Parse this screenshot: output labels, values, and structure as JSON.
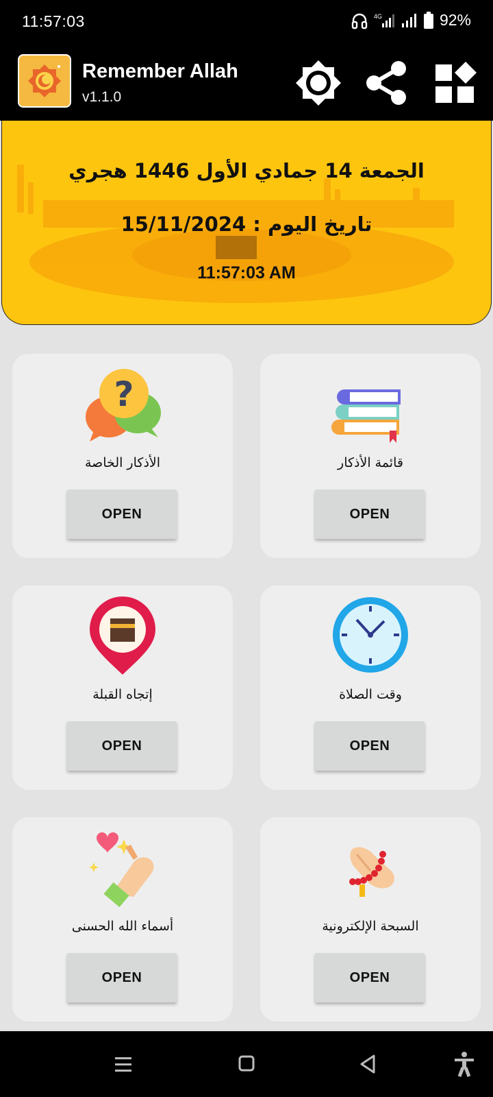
{
  "status_bar": {
    "time": "11:57:03",
    "network": "4G",
    "battery": "92%"
  },
  "app_bar": {
    "title": "Remember Allah",
    "version": "v1.1.0",
    "icons": [
      "brightness-icon",
      "share-icon",
      "apps-icon"
    ]
  },
  "banner": {
    "hijri_date": "الجمعة 14 جمادي الأول 1446 هجري",
    "gregorian_date": "تاريخ اليوم : 15/11/2024",
    "clock": "11:57:03 AM"
  },
  "cards": [
    {
      "label": "الأذكار الخاصة",
      "button": "OPEN",
      "icon": "question-chat-icon"
    },
    {
      "label": "قائمة الأذكار",
      "button": "OPEN",
      "icon": "books-icon"
    },
    {
      "label": "إتجاه القبلة",
      "button": "OPEN",
      "icon": "qibla-pin-icon"
    },
    {
      "label": "وقت الصلاة",
      "button": "OPEN",
      "icon": "clock-icon"
    },
    {
      "label": "أسماء الله الحسنى",
      "button": "OPEN",
      "icon": "praying-hands-icon"
    },
    {
      "label": "السبحة الإلكترونية",
      "button": "OPEN",
      "icon": "tasbih-icon"
    }
  ],
  "colors": {
    "banner": "#fec50f",
    "card": "#eeeeee",
    "button": "#d7d8d8",
    "bars": "#000000"
  }
}
